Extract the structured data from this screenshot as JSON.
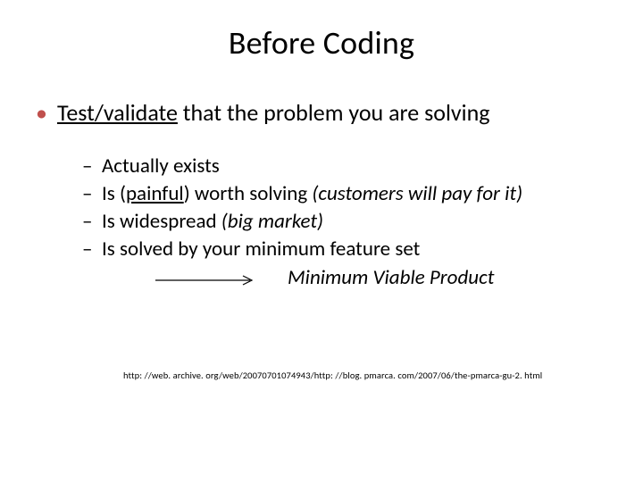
{
  "title": "Before Coding",
  "bullet1_lead": "Test/validate",
  "bullet1_rest": " that the problem you are solving",
  "sub1": "Actually exists",
  "sub2_a": "Is (",
  "sub2_painful": "painful",
  "sub2_b": ") worth solving ",
  "sub2_italic": "(customers will pay for it)",
  "sub3_a": "Is widespread ",
  "sub3_italic": "(big market)",
  "sub4": "Is solved by your minimum feature set",
  "mvp": "Minimum Viable Product",
  "footnote": "http: //web. archive. org/web/20070701074943/http: //blog. pmarca. com/2007/06/the-pmarca-gu-2. html"
}
